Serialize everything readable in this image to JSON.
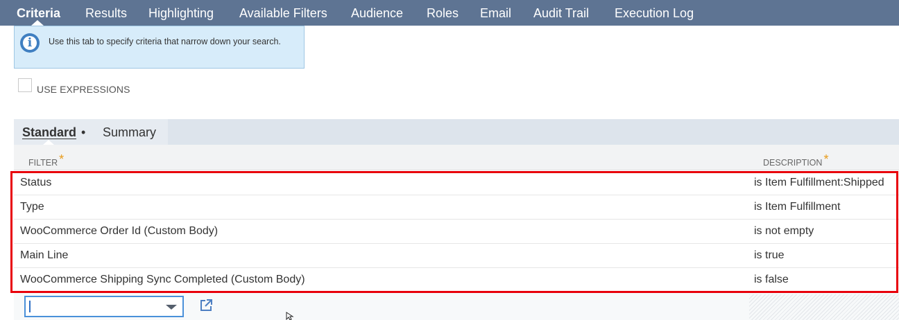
{
  "tabs": [
    {
      "label": "Criteria",
      "active": true
    },
    {
      "label": "Results",
      "active": false
    },
    {
      "label": "Highlighting",
      "active": false
    },
    {
      "label": "Available Filters",
      "active": false
    },
    {
      "label": "Audience",
      "active": false
    },
    {
      "label": "Roles",
      "active": false
    },
    {
      "label": "Email",
      "active": false
    },
    {
      "label": "Audit Trail",
      "active": false
    },
    {
      "label": "Execution Log",
      "active": false
    }
  ],
  "info": {
    "icon": "info-icon",
    "text": "Use this tab to specify criteria that narrow down your search."
  },
  "use_expressions": {
    "label": "USE EXPRESSIONS",
    "checked": false
  },
  "subtabs": [
    {
      "label": "Standard",
      "marker": "•",
      "active": true
    },
    {
      "label": "Summary",
      "active": false
    }
  ],
  "table": {
    "headers": {
      "filter": "FILTER",
      "description": "DESCRIPTION",
      "required_mark": "*"
    },
    "rows": [
      {
        "filter": "Status",
        "description": "is Item Fulfillment:Shipped"
      },
      {
        "filter": "Type",
        "description": "is Item Fulfillment"
      },
      {
        "filter": "WooCommerce Order Id (Custom Body)",
        "description": "is not empty"
      },
      {
        "filter": "Main Line",
        "description": "is true"
      },
      {
        "filter": "WooCommerce Shipping Sync Completed (Custom Body)",
        "description": "is false"
      }
    ]
  },
  "new_filter": {
    "value": "",
    "open_icon": "open-in-new-icon"
  },
  "colors": {
    "tabbar": "#5e7493",
    "info_bg": "#d7ecfa",
    "highlight": "#e8000b",
    "required": "#e89b1a"
  }
}
